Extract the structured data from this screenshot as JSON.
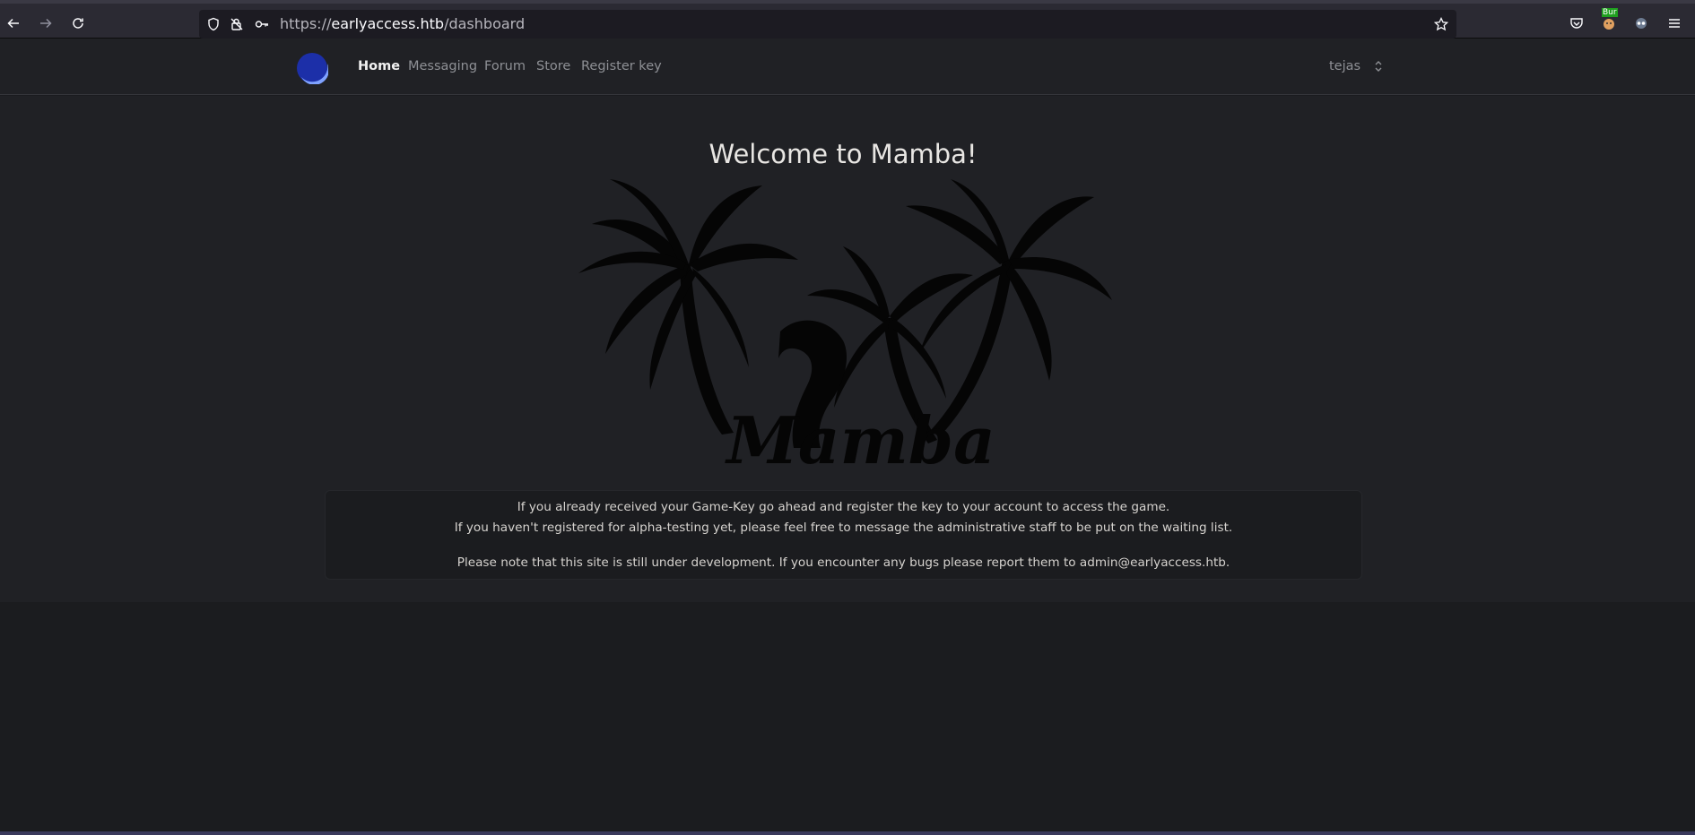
{
  "browser": {
    "url_prefix": "https://",
    "url_domain": "earlyaccess.htb",
    "url_path": "/dashboard",
    "extension_badge": "Bur"
  },
  "nav": {
    "items": [
      {
        "label": "Home",
        "active": true
      },
      {
        "label": "Messaging",
        "active": false
      },
      {
        "label": "Forum",
        "active": false
      },
      {
        "label": "Store",
        "active": false
      },
      {
        "label": "Register key",
        "active": false
      }
    ],
    "username": "tejas"
  },
  "main": {
    "title": "Welcome to Mamba!",
    "logo_text": "Mamba",
    "info_line1": "If you already received your Game-Key go ahead and register the key to your account to access the game.",
    "info_line2": "If you haven't registered for alpha-testing yet, please feel free to message the administrative staff to be put on the waiting list.",
    "info_line3": "Please note that this site is still under development. If you encounter any bugs please report them to admin@earlyaccess.htb."
  },
  "colors": {
    "page_bg": "#202125",
    "accent": "#3b6ee8",
    "text": "#e8e6e3"
  }
}
